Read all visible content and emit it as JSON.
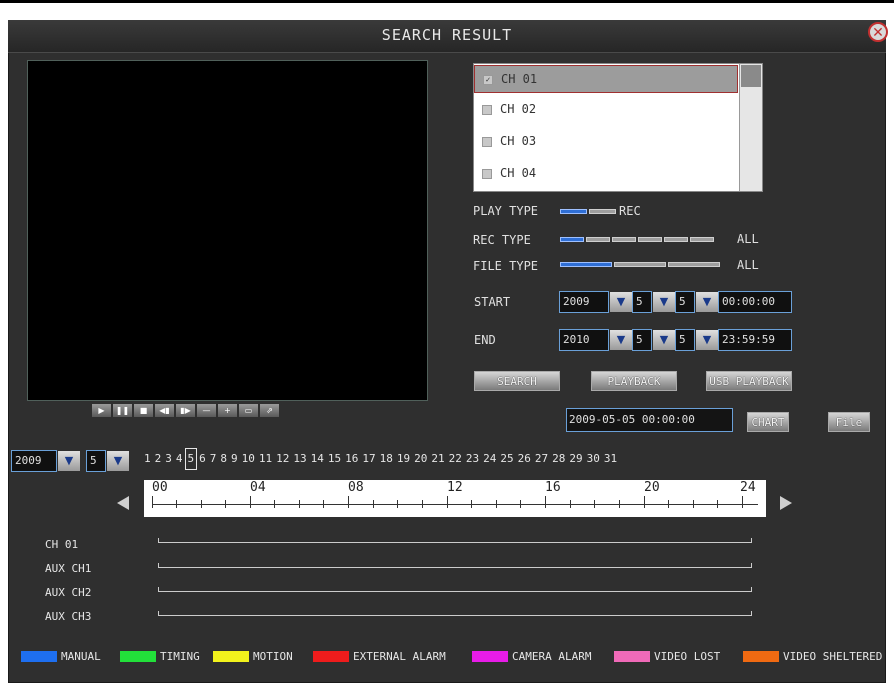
{
  "window": {
    "title": "SEARCH RESULT",
    "close_icon": "close-icon"
  },
  "player_buttons": [
    "▶",
    "❚❚",
    "■",
    "◀▮",
    "▮▶",
    "—",
    "+",
    "▭",
    "⇗"
  ],
  "channels": [
    {
      "label": "CH 01",
      "checked": true
    },
    {
      "label": "CH 02",
      "checked": false
    },
    {
      "label": "CH 03",
      "checked": false
    },
    {
      "label": "CH 04",
      "checked": false
    }
  ],
  "play_type": {
    "label": "PLAY TYPE",
    "value": "REC"
  },
  "rec_type": {
    "label": "REC TYPE",
    "value": "ALL"
  },
  "file_type": {
    "label": "FILE TYPE",
    "value": "ALL"
  },
  "start": {
    "label": "START",
    "year": "2009",
    "month": "5",
    "day": "5",
    "time": "00:00:00"
  },
  "end": {
    "label": "END",
    "year": "2010",
    "month": "5",
    "day": "5",
    "time": "23:59:59"
  },
  "buttons": {
    "search": "SEARCH",
    "playback": "PLAYBACK",
    "usb_playback": "USB PLAYBACK",
    "chart": "CHART",
    "file": "File"
  },
  "current_time": "2009-05-05  00:00:00",
  "calendar": {
    "year": "2009",
    "month": "5",
    "selected_day": "5",
    "days": [
      "1",
      "2",
      "3",
      "4",
      "5",
      "6",
      "7",
      "8",
      "9",
      "10",
      "11",
      "12",
      "13",
      "14",
      "15",
      "16",
      "17",
      "18",
      "19",
      "20",
      "21",
      "22",
      "23",
      "24",
      "25",
      "26",
      "27",
      "28",
      "29",
      "30",
      "31"
    ]
  },
  "timeline_labels": [
    "00",
    "04",
    "08",
    "12",
    "16",
    "20",
    "24"
  ],
  "track_labels": [
    "CH 01",
    "AUX CH1",
    "AUX CH2",
    "AUX CH3"
  ],
  "legend": [
    {
      "label": "MANUAL",
      "color": "#1e6ff0"
    },
    {
      "label": "TIMING",
      "color": "#22e03a"
    },
    {
      "label": "MOTION",
      "color": "#f2f21c"
    },
    {
      "label": "EXTERNAL ALARM",
      "color": "#ee1c1c"
    },
    {
      "label": "CAMERA ALARM",
      "color": "#e81ce8"
    },
    {
      "label": "VIDEO LOST",
      "color": "#f06ab8"
    },
    {
      "label": "VIDEO SHELTERED",
      "color": "#f06a12"
    }
  ]
}
